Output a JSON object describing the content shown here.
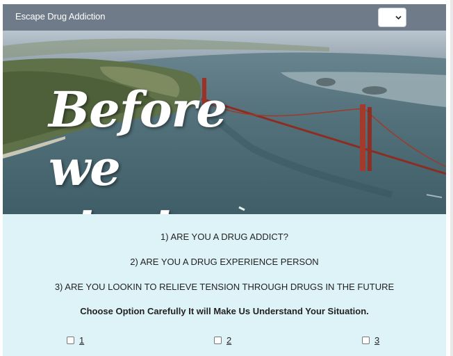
{
  "navbar": {
    "brand": "Escape Drug Addiction",
    "language_select": {
      "value": "",
      "icon": "chevron-down-icon"
    }
  },
  "hero": {
    "title": "Before we start....",
    "image": "golden-gate-bridge-aerial"
  },
  "questions": [
    "1) ARE YOU A DRUG ADDICT?",
    "2) ARE YOU A DRUG EXPERIENCE PERSON",
    "3) ARE YOU LOOKIN TO RELIEVE TENSION THROUGH DRUGS IN  THE FUTURE"
  ],
  "note": "Choose Option Carefully It will Make Us Understand Your Situation.",
  "options": [
    {
      "label": "1",
      "checked": false
    },
    {
      "label": "2",
      "checked": false
    },
    {
      "label": "3",
      "checked": false
    }
  ],
  "colors": {
    "navbar": "#707b89",
    "content_bg": "#def3f8"
  }
}
